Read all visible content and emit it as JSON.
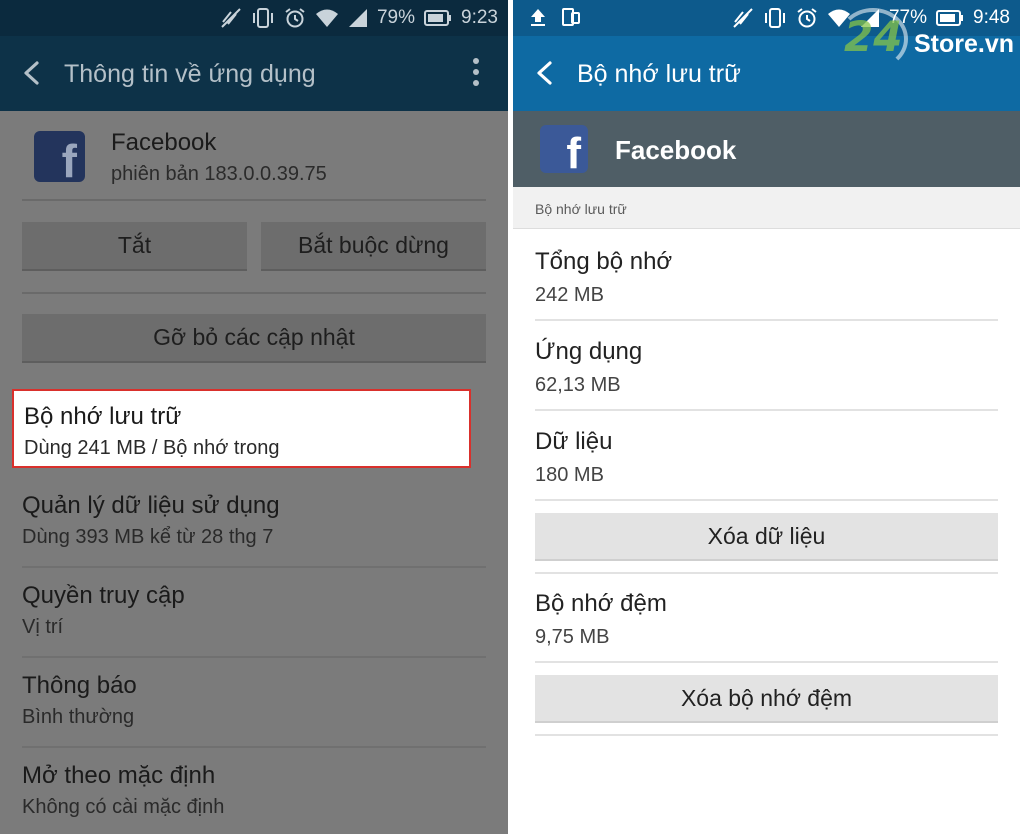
{
  "left": {
    "status": {
      "battery": "79%",
      "time": "9:23"
    },
    "appbar": {
      "title": "Thông tin về ứng dụng"
    },
    "app": {
      "name": "Facebook",
      "version": "phiên bản 183.0.0.39.75"
    },
    "buttons": {
      "disable": "Tắt",
      "force_stop": "Bắt buộc dừng",
      "uninstall_updates": "Gỡ bỏ các cập nhật"
    },
    "rows": [
      {
        "title": "Bộ nhớ lưu trữ",
        "subtitle": "Dùng 241 MB / Bộ nhớ trong"
      },
      {
        "title": "Quản lý dữ liệu sử dụng",
        "subtitle": "Dùng 393 MB kể từ 28 thg 7"
      },
      {
        "title": "Quyền truy cập",
        "subtitle": "Vị trí"
      },
      {
        "title": "Thông báo",
        "subtitle": "Bình thường"
      },
      {
        "title": "Mở theo mặc định",
        "subtitle": "Không có cài mặc định"
      }
    ]
  },
  "right": {
    "status": {
      "battery": "77%",
      "time": "9:48"
    },
    "appbar": {
      "title": "Bộ nhớ lưu trữ"
    },
    "app": {
      "name": "Facebook"
    },
    "section": "Bộ nhớ lưu trữ",
    "rows": [
      {
        "title": "Tổng bộ nhớ",
        "value": "242 MB"
      },
      {
        "title": "Ứng dụng",
        "value": "62,13 MB"
      },
      {
        "title": "Dữ liệu",
        "value": "180 MB"
      }
    ],
    "clear_data_button": "Xóa dữ liệu",
    "cache": {
      "title": "Bộ nhớ đệm",
      "value": "9,75 MB"
    },
    "clear_cache_button": "Xóa bộ nhớ đệm"
  },
  "watermark": {
    "number": "24",
    "brand": "Store.vn"
  },
  "icons": [
    "no-sync-icon",
    "vibrate-icon",
    "alarm-icon",
    "wifi-icon",
    "signal-icon",
    "battery-icon",
    "back-arrow-icon",
    "more-vert-icon",
    "upload-icon",
    "device-icon",
    "facebook-logo-icon"
  ],
  "colors": {
    "left_appbar": "#0d3248",
    "right_appbar": "#0e6aa3",
    "highlight_border": "#d9302c",
    "facebook_blue": "#3b5998"
  }
}
